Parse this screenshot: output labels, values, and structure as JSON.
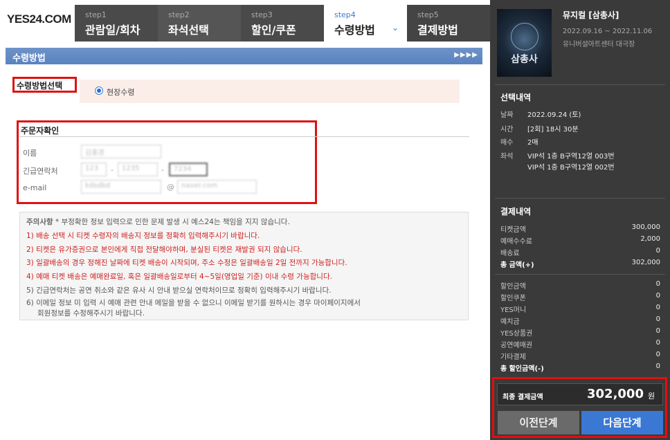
{
  "header": {
    "logo": "YES24.COM",
    "steps": [
      {
        "num": "step1",
        "label": "관람일/회차"
      },
      {
        "num": "step2",
        "label": "좌석선택"
      },
      {
        "num": "step3",
        "label": "할인/쿠폰"
      },
      {
        "num": "step4",
        "label": "수령방법",
        "active": true
      },
      {
        "num": "step5",
        "label": "결제방법"
      }
    ]
  },
  "section_title": "수령방법",
  "delivery": {
    "label": "수령방법선택",
    "option": "현장수령"
  },
  "orderer": {
    "label": "주문자확인",
    "name_label": "이름",
    "name_value": "김홍경",
    "phone_label": "긴급연락처",
    "phone_values": [
      "123",
      "1235",
      "7234"
    ],
    "email_label": "e-mail",
    "email_id": "kdsdbd",
    "email_at": "@",
    "email_domain": "naver.com"
  },
  "notes": {
    "title": "주의사항",
    "intro": "* 부정확한 정보 입력으로 인한 문제 발생 시 예스24는 책임을 지지 않습니다.",
    "items": [
      "1) 배송 선택 시 티켓 수령자의 배송지 정보를 정확히 입력해주시기 바랍니다.",
      "2) 티켓은 유가증권으로 본인에게 직접 전달해야하며, 분실된 티켓은 재발권 되지 않습니다.",
      "3) 일괄배송의 경우 정해진 날짜에 티켓 배송이 시작되며, 주소 수정은 일괄배송일 2일 전까지 가능합니다.",
      "4) 예매 티켓 배송은 예매완료일, 혹은 일괄배송일로부터 4~5일(영업일 기준) 이내 수령 가능합니다.",
      "5) 긴급연락처는 공연 취소와 같은 유사 시 안내 받으실 연락처이므로 정확히 입력해주시기 바랍니다.",
      "6) 이메일 정보 미 입력 시 예매 관련 안내 메일을 받을 수 없으니 이메일 받기를 원하시는 경우 마이페이지에서",
      "회원정보를 수정해주시기 바랍니다."
    ]
  },
  "show": {
    "title": "뮤지컬 [삼총사]",
    "poster_text": "삼총사",
    "dates": "2022.09.16 ~ 2022.11.06",
    "venue": "유니버설아트센터 대극장"
  },
  "selection": {
    "heading": "선택내역",
    "date_k": "날짜",
    "date_v": "2022.09.24 (토)",
    "time_k": "시간",
    "time_v": "[2회] 18시 30분",
    "count_k": "매수",
    "count_v": "2매",
    "seat_k": "좌석",
    "seat_v1": "VIP석 1층 B구역12열 003번",
    "seat_v2": "VIP석 1층 B구역12열 002번"
  },
  "payment": {
    "heading": "결제내역",
    "rows": [
      {
        "k": "티켓금액",
        "v": "300,000"
      },
      {
        "k": "예매수수료",
        "v": "2,000"
      },
      {
        "k": "배송료",
        "v": "0"
      },
      {
        "k": "총 금액(+)",
        "v": "302,000"
      }
    ],
    "discounts": [
      {
        "k": "할인금액",
        "v": "0"
      },
      {
        "k": "할인쿠폰",
        "v": "0"
      },
      {
        "k": "YES머니",
        "v": "0"
      },
      {
        "k": "예치금",
        "v": "0"
      },
      {
        "k": "YES상품권",
        "v": "0"
      },
      {
        "k": "공연예매권",
        "v": "0"
      },
      {
        "k": "기타결제",
        "v": "0"
      },
      {
        "k": "총 할인금액(-)",
        "v": "0"
      }
    ],
    "final_label": "최종 결제금액",
    "final_amount": "302,000",
    "final_unit": "원"
  },
  "buttons": {
    "prev": "이전단계",
    "next": "다음단계"
  }
}
